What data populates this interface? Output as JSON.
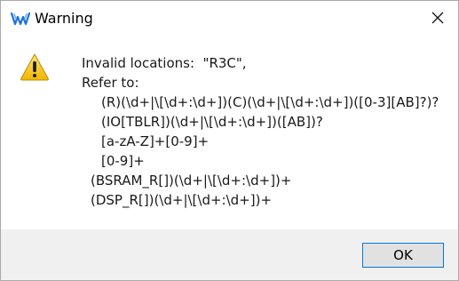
{
  "window": {
    "title": "Warning",
    "app_icon": "gowin-logo-icon",
    "close_icon": "close-icon"
  },
  "message": {
    "icon": "warning-triangle-icon",
    "lines": [
      {
        "indent": 0,
        "text": "Invalid locations:  \"R3C\","
      },
      {
        "indent": 0,
        "text": "Refer to:"
      },
      {
        "indent": 22,
        "text": "(R)(\\d+|\\[\\d+:\\d+])(C)(\\d+|\\[\\d+:\\d+])([0-3][AB]?)?"
      },
      {
        "indent": 22,
        "text": "(IO[TBLR])(\\d+|\\[\\d+:\\d+])([AB])?"
      },
      {
        "indent": 22,
        "text": "[a-zA-Z]+[0-9]+"
      },
      {
        "indent": 22,
        "text": "[0-9]+"
      },
      {
        "indent": 10,
        "text": "(BSRAM_R[])(\\d+|\\[\\d+:\\d+])+"
      },
      {
        "indent": 10,
        "text": "(DSP_R[])(\\d+|\\[\\d+:\\d+])+"
      }
    ]
  },
  "footer": {
    "ok_label": "OK"
  },
  "colors": {
    "accent": "#0078d7",
    "warning_yellow": "#f5c518",
    "footer_bg": "#f0f0f0"
  }
}
